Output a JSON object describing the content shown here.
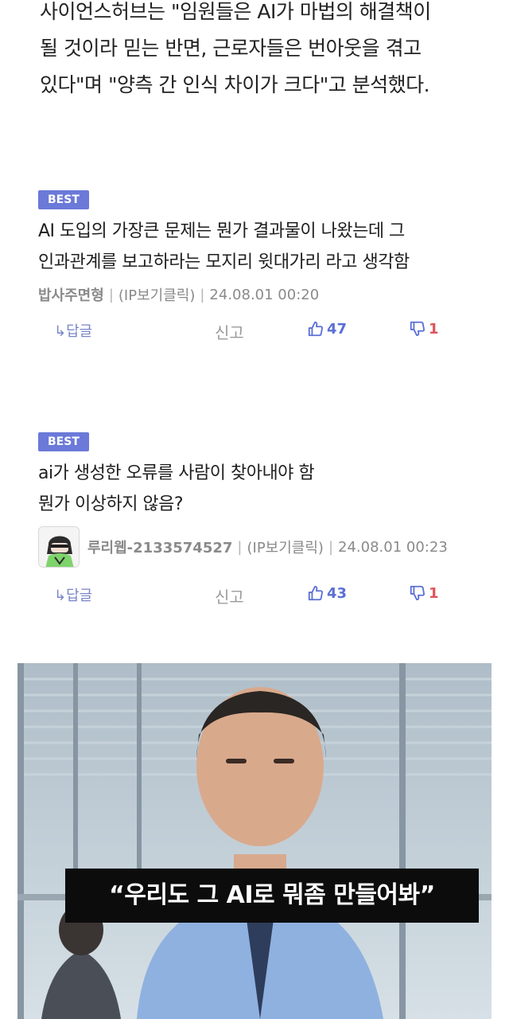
{
  "article": {
    "lines": [
      "사이언스허브는 \"임원들은 AI가 마법의 해결책이",
      "될 것이라 믿는 반면, 근로자들은 번아웃을 겪고",
      "있다\"며 \"양측 간 인식 차이가 크다\"고 분석했다."
    ]
  },
  "comments": [
    {
      "badge": "BEST",
      "lines": [
        "AI 도입의 가장큰 문제는 뭔가 결과물이 나왔는데 그",
        "인과관계를 보고하라는 모지리 윗대가리 라고 생각함"
      ],
      "nick": "밥사주면형",
      "ip": "(IP보기클릭)",
      "time": "24.08.01 00:20",
      "reply": "↳답글",
      "report": "신고",
      "likes": "47",
      "dislikes": "1"
    },
    {
      "badge": "BEST",
      "lines": [
        "ai가 생성한 오류를 사람이 찾아내야 함",
        "뭔가 이상하지 않음?"
      ],
      "nick": "루리웹-2133574527",
      "ip": "(IP보기클릭)",
      "time": "24.08.01 00:23",
      "reply": "↳답글",
      "report": "신고",
      "likes": "43",
      "dislikes": "1"
    }
  ],
  "photo": {
    "caption": "“우리도 그 AI로 뭐좀 만들어봐”"
  },
  "colors": {
    "badge": "#6b79d8",
    "like": "#5b6fd6",
    "dislike": "#e0525c"
  }
}
